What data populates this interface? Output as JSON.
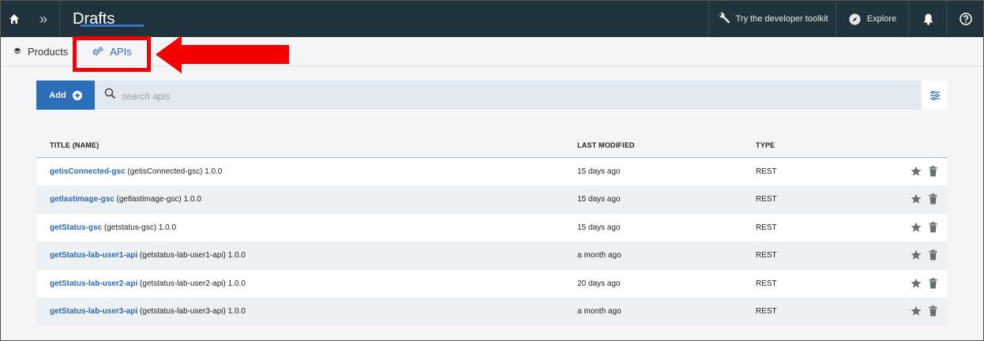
{
  "topbar": {
    "title": "Drafts",
    "toolkit_label": "Try the developer toolkit",
    "explore_label": "Explore"
  },
  "tabs": [
    {
      "label": "Products",
      "icon": "layers-icon",
      "selected": false
    },
    {
      "label": "APIs",
      "icon": "gears-icon",
      "selected": true
    }
  ],
  "toolbar": {
    "add_label": "Add",
    "search_placeholder": "search apis"
  },
  "table": {
    "headers": {
      "title": "TITLE (NAME)",
      "modified": "LAST MODIFIED",
      "type": "TYPE"
    },
    "rows": [
      {
        "title": "getisConnected-gsc",
        "name": "(getisConnected-gsc) 1.0.0",
        "modified": "15 days ago",
        "type": "REST"
      },
      {
        "title": "getlastimage-gsc",
        "name": "(getlastimage-gsc) 1.0.0",
        "modified": "15 days ago",
        "type": "REST"
      },
      {
        "title": "getStatus-gsc",
        "name": "(getstatus-gsc) 1.0.0",
        "modified": "15 days ago",
        "type": "REST"
      },
      {
        "title": "getStatus-lab-user1-api",
        "name": "(getstatus-lab-user1-api) 1.0.0",
        "modified": "a month ago",
        "type": "REST"
      },
      {
        "title": "getStatus-lab-user2-api",
        "name": "(getstatus-lab-user2-api) 1.0.0",
        "modified": "20 days ago",
        "type": "REST"
      },
      {
        "title": "getStatus-lab-user3-api",
        "name": "(getstatus-lab-user3-api) 1.0.0",
        "modified": "a month ago",
        "type": "REST"
      }
    ]
  },
  "colors": {
    "topbar_bg": "#21333d",
    "accent_blue": "#2c6fb8",
    "link_blue": "#2c69ae",
    "highlight_red": "#f40000"
  }
}
